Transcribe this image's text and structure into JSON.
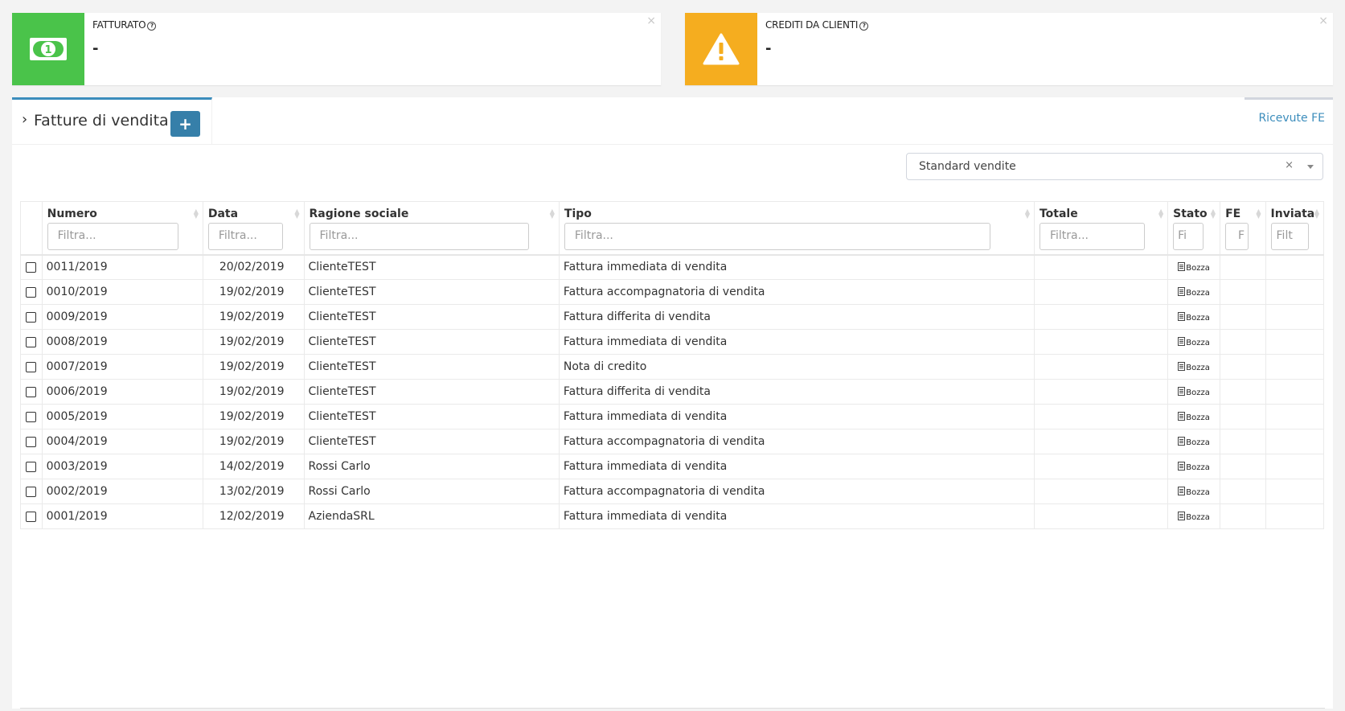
{
  "kpi": [
    {
      "title": "FATTURATO",
      "value": "-",
      "color": "#4ac34a",
      "icon": "banknote-icon"
    },
    {
      "title": "CREDITI DA CLIENTI",
      "value": "-",
      "color": "#f5ad1f",
      "icon": "warning-icon"
    }
  ],
  "help_glyph": "?",
  "close_glyph": "×",
  "tab": {
    "label": "Fatture di vendita",
    "chevron": "›",
    "add_glyph": "+",
    "right_label": "Ricevute FE"
  },
  "segment": {
    "value": "Standard vendite",
    "clear": "×"
  },
  "table": {
    "columns": [
      {
        "key": "numero",
        "label": "Numero",
        "filter": "Filtra..."
      },
      {
        "key": "data",
        "label": "Data",
        "filter": "Filtra..."
      },
      {
        "key": "ragione",
        "label": "Ragione sociale",
        "filter": "Filtra..."
      },
      {
        "key": "tipo",
        "label": "Tipo",
        "filter": "Filtra..."
      },
      {
        "key": "totale",
        "label": "Totale",
        "filter": "Filtra..."
      },
      {
        "key": "stato",
        "label": "Stato",
        "filter": "Fi"
      },
      {
        "key": "fe",
        "label": "FE",
        "filter": "F"
      },
      {
        "key": "inviata",
        "label": "Inviata",
        "filter": "Filt"
      }
    ],
    "rows": [
      {
        "numero": "0011/2019",
        "data": "20/02/2019",
        "ragione": "ClienteTEST",
        "tipo": "Fattura immediata di vendita",
        "stato": "Bozza"
      },
      {
        "numero": "0010/2019",
        "data": "19/02/2019",
        "ragione": "ClienteTEST",
        "tipo": "Fattura accompagnatoria di vendita",
        "stato": "Bozza"
      },
      {
        "numero": "0009/2019",
        "data": "19/02/2019",
        "ragione": "ClienteTEST",
        "tipo": "Fattura differita di vendita",
        "stato": "Bozza"
      },
      {
        "numero": "0008/2019",
        "data": "19/02/2019",
        "ragione": "ClienteTEST",
        "tipo": "Fattura immediata di vendita",
        "stato": "Bozza"
      },
      {
        "numero": "0007/2019",
        "data": "19/02/2019",
        "ragione": "ClienteTEST",
        "tipo": "Nota di credito",
        "stato": "Bozza"
      },
      {
        "numero": "0006/2019",
        "data": "19/02/2019",
        "ragione": "ClienteTEST",
        "tipo": "Fattura differita di vendita",
        "stato": "Bozza"
      },
      {
        "numero": "0005/2019",
        "data": "19/02/2019",
        "ragione": "ClienteTEST",
        "tipo": "Fattura immediata di vendita",
        "stato": "Bozza"
      },
      {
        "numero": "0004/2019",
        "data": "19/02/2019",
        "ragione": "ClienteTEST",
        "tipo": "Fattura accompagnatoria di vendita",
        "stato": "Bozza"
      },
      {
        "numero": "0003/2019",
        "data": "14/02/2019",
        "ragione": "Rossi Carlo",
        "tipo": "Fattura immediata di vendita",
        "stato": "Bozza"
      },
      {
        "numero": "0002/2019",
        "data": "13/02/2019",
        "ragione": "Rossi Carlo",
        "tipo": "Fattura accompagnatoria di vendita",
        "stato": "Bozza"
      },
      {
        "numero": "0001/2019",
        "data": "12/02/2019",
        "ragione": "AziendaSRL",
        "tipo": "Fattura immediata di vendita",
        "stato": "Bozza"
      }
    ]
  }
}
